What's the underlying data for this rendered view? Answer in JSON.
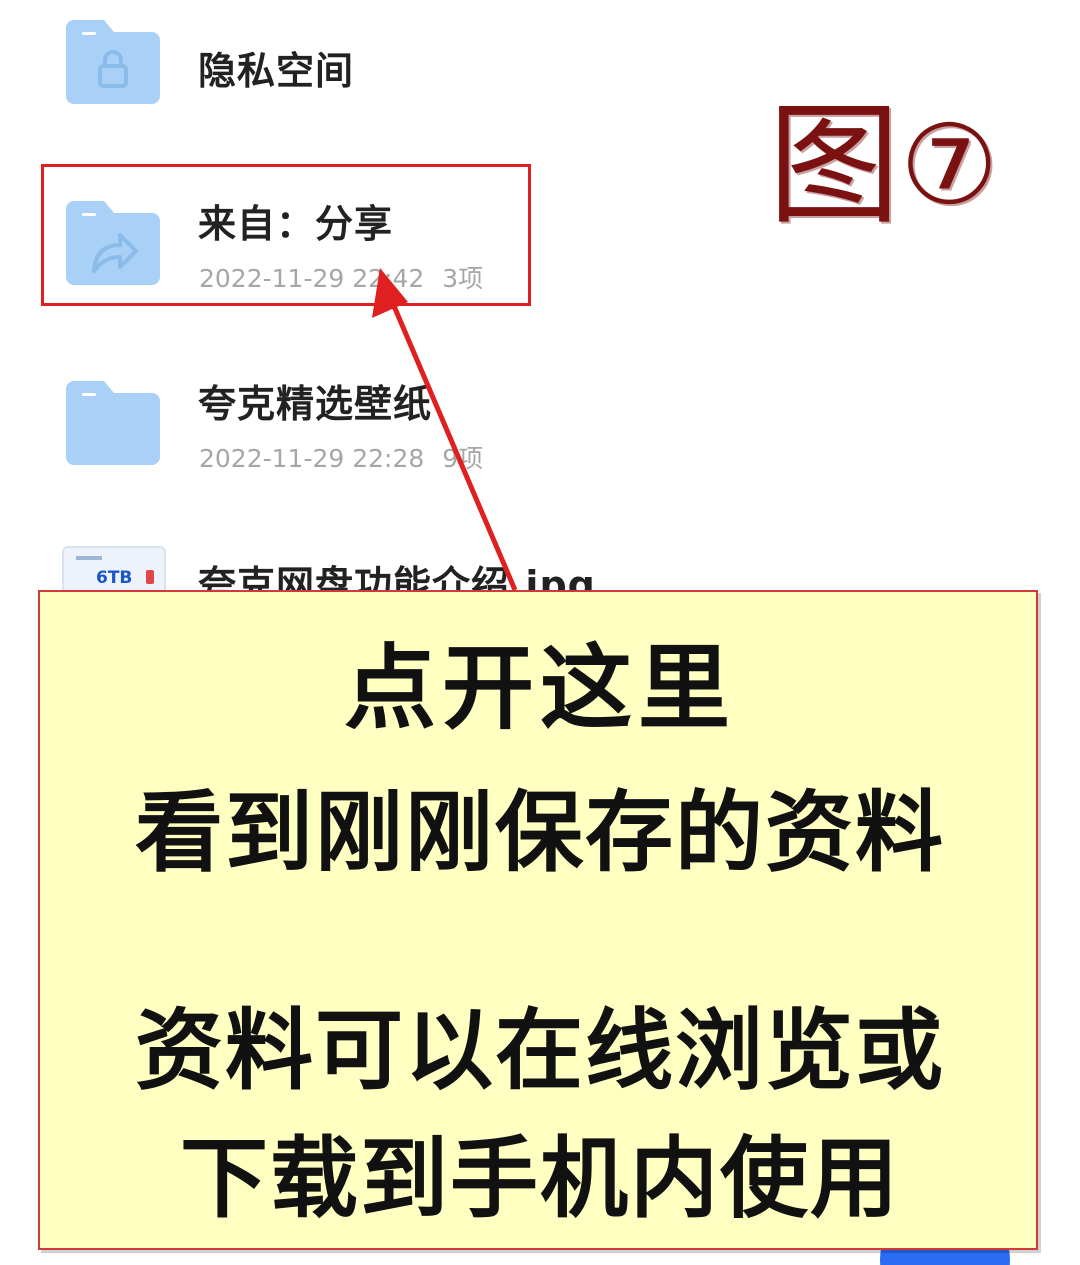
{
  "files": [
    {
      "name": "隐私空间",
      "date": "",
      "count": "",
      "icon": "lock-folder-icon"
    },
    {
      "name": "来自：分享",
      "date": "2022-11-29 22:42",
      "count": "3项",
      "icon": "share-folder-icon"
    },
    {
      "name": "夸克精选壁纸",
      "date": "2022-11-29 22:28",
      "count": "9项",
      "icon": "folder-icon"
    },
    {
      "name": "夸克网盘功能介绍.jpg",
      "date": "",
      "count": "",
      "icon": "image-thumbnail-icon",
      "thumb_text": "6TB"
    }
  ],
  "annotation": {
    "figure_label": "图",
    "figure_number": "⑦",
    "note_lines": [
      "点开这里",
      "看到刚刚保存的资料",
      "资料可以在线浏览或",
      "下载到手机内使用"
    ]
  },
  "colors": {
    "folder": "#a9d0f6",
    "highlight": "#e02020",
    "note_bg": "#ffffc2",
    "figure_label": "#7a1212",
    "fab": "#2a6df4"
  }
}
